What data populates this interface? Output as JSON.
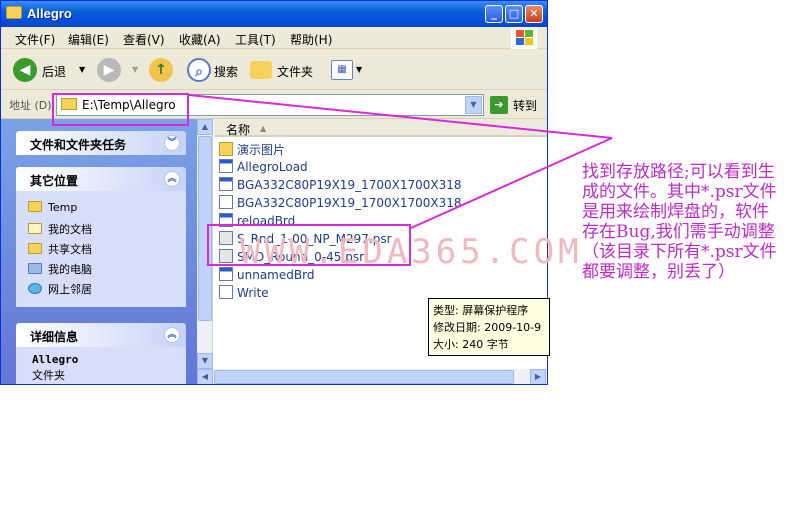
{
  "window": {
    "title": "Allegro",
    "controls": [
      "minimize",
      "maximize",
      "close"
    ]
  },
  "menu": [
    "文件(F)",
    "编辑(E)",
    "查看(V)",
    "收藏(A)",
    "工具(T)",
    "帮助(H)"
  ],
  "toolbar": {
    "back_label": "后退",
    "search_label": "搜索",
    "folders_label": "文件夹"
  },
  "address": {
    "label": "地址 (D)",
    "value": "E:\\Temp\\Allegro",
    "go_label": "转到"
  },
  "left_panel": {
    "tasks_title": "文件和文件夹任务",
    "places_title": "其它位置",
    "places": [
      "Temp",
      "我的文档",
      "共享文档",
      "我的电脑",
      "网上邻居"
    ],
    "details_title": "详细信息",
    "details_name": "Allegro",
    "details_type": "文件夹"
  },
  "file_list": {
    "column_name": "名称",
    "files": [
      {
        "name": "演示图片",
        "icon": "folder-icon"
      },
      {
        "name": "AllegroLoad",
        "icon": "exe-icon"
      },
      {
        "name": "BGA332C80P19X19_1700X1700X318",
        "icon": "exe-icon"
      },
      {
        "name": "BGA332C80P19X19_1700X1700X318",
        "icon": "text-file-icon"
      },
      {
        "name": "reloadBrd",
        "icon": "exe-icon"
      },
      {
        "name": "S_Rnd_1-00_NP_M297.psr",
        "icon": "psr-file-icon"
      },
      {
        "name": "SMD_Round_0-45.psr",
        "icon": "psr-file-icon"
      },
      {
        "name": "unnamedBrd",
        "icon": "exe-icon"
      },
      {
        "name": "Write",
        "icon": "write-icon"
      }
    ]
  },
  "tooltip": {
    "type_line": "类型: 屏幕保护程序",
    "date_line": "修改日期: 2009-10-9",
    "size_line": "大小: 240 字节"
  },
  "watermark": "WWW.EDA365.COM",
  "annotation": {
    "text": "找到存放路径;可以看到生成的文件。其中*.psr文件是用来绘制焊盘的，软件存在Bug,我们需手动调整（该目录下所有*.psr文件都要调整，别丢了）",
    "color": "#c02ac8"
  }
}
